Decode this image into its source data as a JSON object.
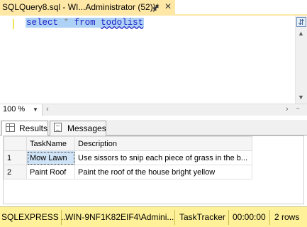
{
  "document_tab": {
    "title": "SQLQuery8.sql - WI...Administrator (52))*",
    "pin_icon": "pin-icon",
    "close_icon": "close-icon"
  },
  "editor": {
    "keyword_select": "select",
    "star": "*",
    "keyword_from": "from",
    "table": "todolist"
  },
  "zoom": {
    "value": "100 %"
  },
  "result_tabs": {
    "results_label": "Results",
    "messages_label": "Messages"
  },
  "grid": {
    "columns": [
      "",
      "TaskName",
      "Description"
    ],
    "rows": [
      {
        "index": "1",
        "task_name": "Mow Lawn",
        "description": "Use sissors to snip each piece of grass in the b..."
      },
      {
        "index": "2",
        "task_name": "Paint Roof",
        "description": "Paint the roof of the house bright yellow"
      }
    ]
  },
  "status_bar": {
    "server": "SQLEXPRESS ...",
    "user": "WIN-9NF1K82EIF4\\Admini...",
    "database": "TaskTracker",
    "elapsed": "00:00:00",
    "rows": "2 rows"
  },
  "colors": {
    "tab_active": "#ffe8a6",
    "status_bar": "#fff199",
    "selection": "#aed2f5",
    "keyword": "#1f1fc8"
  }
}
